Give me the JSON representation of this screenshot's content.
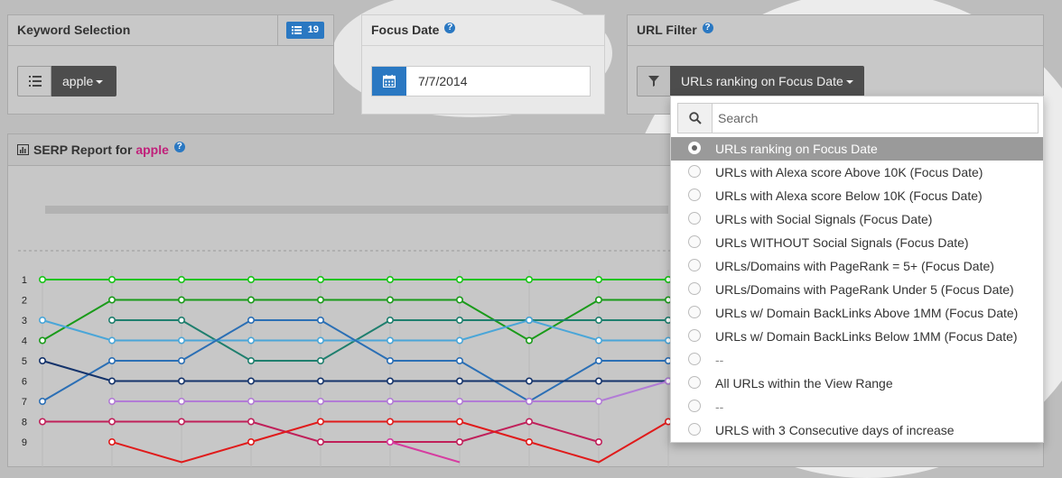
{
  "keyword_panel": {
    "title": "Keyword Selection",
    "count_badge": "19",
    "selected_keyword": "apple"
  },
  "focus_panel": {
    "title": "Focus Date",
    "help": "?",
    "date_value": "7/7/2014"
  },
  "url_panel": {
    "title": "URL Filter",
    "help": "?",
    "selected_filter": "URLs ranking on Focus Date"
  },
  "dropdown": {
    "search_placeholder": "Search",
    "options": [
      {
        "label": "URLs ranking on Focus Date",
        "selected": true
      },
      {
        "label": "URLs with Alexa score Above 10K (Focus Date)"
      },
      {
        "label": "URLs with Alexa score Below 10K (Focus Date)"
      },
      {
        "label": "URLs with Social Signals (Focus Date)"
      },
      {
        "label": "URLs WITHOUT Social Signals (Focus Date)"
      },
      {
        "label": "URLs/Domains with PageRank = 5+ (Focus Date)"
      },
      {
        "label": "URLs/Domains with PageRank Under 5 (Focus Date)"
      },
      {
        "label": "URLs w/ Domain BackLinks Above 1MM (Focus Date)"
      },
      {
        "label": "URLs w/ Domain BackLinks Below 1MM (Focus Date)"
      },
      {
        "label": "--"
      },
      {
        "label": "All URLs within the View Range"
      },
      {
        "label": "--"
      },
      {
        "label": "URLS with 3 Consecutive days of increase"
      }
    ]
  },
  "serp_panel": {
    "title_prefix": "SERP Report for ",
    "keyword": "apple",
    "help": "?"
  },
  "chart_data": {
    "type": "line",
    "y_ticks": [
      "1",
      "2",
      "3",
      "4",
      "5",
      "6",
      "7",
      "8",
      "9"
    ],
    "y_inverted": true,
    "x_count": 10,
    "series": [
      {
        "color": "#18c418",
        "values": [
          1,
          1,
          1,
          1,
          1,
          1,
          1,
          1,
          1,
          1
        ]
      },
      {
        "color": "#1a9b1a",
        "values": [
          4,
          2,
          2,
          2,
          2,
          2,
          2,
          4,
          2,
          2
        ]
      },
      {
        "color": "#1f7f6e",
        "values": [
          null,
          3,
          3,
          5,
          5,
          3,
          3,
          3,
          3,
          3
        ]
      },
      {
        "color": "#4aa6d8",
        "values": [
          3,
          4,
          4,
          4,
          4,
          4,
          4,
          3,
          4,
          4
        ]
      },
      {
        "color": "#2b6fb5",
        "values": [
          7,
          5,
          5,
          3,
          3,
          5,
          5,
          7,
          5,
          5
        ]
      },
      {
        "color": "#14336b",
        "values": [
          5,
          6,
          6,
          6,
          6,
          6,
          6,
          6,
          6,
          6
        ]
      },
      {
        "color": "#b27cd6",
        "values": [
          null,
          7,
          7,
          7,
          7,
          7,
          7,
          7,
          7,
          6
        ]
      },
      {
        "color": "#c0205a",
        "values": [
          8,
          8,
          8,
          8,
          9,
          9,
          9,
          8,
          9,
          null
        ]
      },
      {
        "color": "#e01b1b",
        "values": [
          null,
          9,
          10,
          9,
          8,
          8,
          8,
          9,
          10,
          8
        ]
      },
      {
        "color": "#d63ca0",
        "values": [
          null,
          null,
          null,
          null,
          null,
          9,
          10,
          null,
          null,
          null
        ]
      }
    ]
  },
  "colors": {
    "accent_blue": "#2a78c2",
    "keyword_pink": "#c0207a",
    "dark_button": "#4d4d4d"
  }
}
